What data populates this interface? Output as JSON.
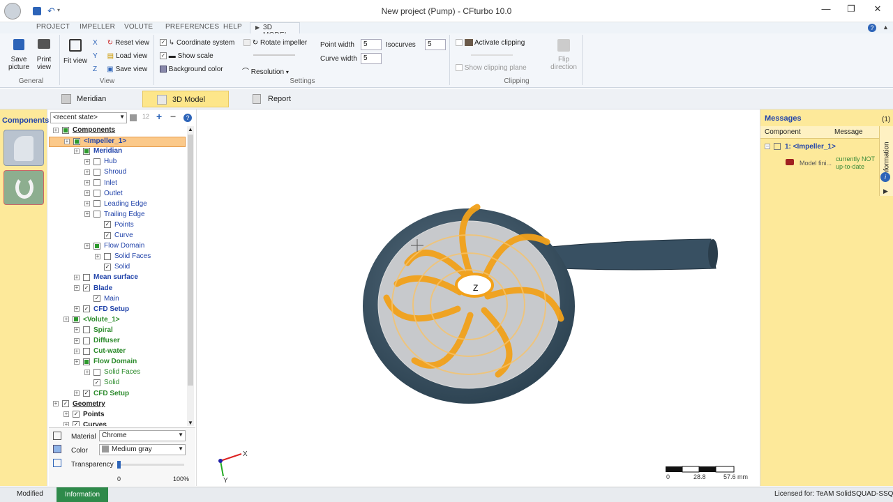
{
  "window": {
    "title": "New project (Pump) - CFturbo 10.0"
  },
  "ribbon_tabs": [
    "PROJECT",
    "IMPELLER",
    "VOLUTE",
    "PREFERENCES",
    "HELP",
    "3D MODEL"
  ],
  "general": {
    "save_picture": "Save picture",
    "print_view": "Print view",
    "label": "General"
  },
  "view": {
    "fit_view": "Fit view",
    "reset_view": "Reset view",
    "load_view": "Load view",
    "save_view": "Save view",
    "label": "View"
  },
  "settings": {
    "coordinate_system": "Coordinate system",
    "show_scale": "Show scale",
    "background_color": "Background color",
    "rotate_impeller": "Rotate impeller",
    "resolution": "Resolution",
    "point_width_label": "Point width",
    "point_width": "5",
    "curve_width_label": "Curve width",
    "curve_width": "5",
    "isocurves_label": "Isocurves",
    "isocurves": "5",
    "label": "Settings"
  },
  "clipping": {
    "activate": "Activate clipping",
    "show_plane": "Show clipping plane",
    "flip": "Flip direction",
    "label": "Clipping"
  },
  "view_tabs": {
    "meridian": "Meridian",
    "model3d": "3D Model",
    "report": "Report"
  },
  "left_bar": {
    "title": "Components"
  },
  "tree": {
    "state_select": "<recent state>",
    "items": [
      {
        "label": "Components",
        "style": "bold-ul",
        "level": 0,
        "check": "f"
      },
      {
        "label": "<Impeller_1>",
        "style": "sel",
        "level": 1,
        "check": "f"
      },
      {
        "label": "Meridian",
        "style": "bold-blue",
        "level": 2,
        "check": "f"
      },
      {
        "label": "Hub",
        "style": "blue",
        "level": 3,
        "check": ""
      },
      {
        "label": "Shroud",
        "style": "blue",
        "level": 3,
        "check": ""
      },
      {
        "label": "Inlet",
        "style": "blue",
        "level": 3,
        "check": ""
      },
      {
        "label": "Outlet",
        "style": "blue",
        "level": 3,
        "check": ""
      },
      {
        "label": "Leading Edge",
        "style": "blue",
        "level": 3,
        "check": ""
      },
      {
        "label": "Trailing Edge",
        "style": "blue",
        "level": 3,
        "check": ""
      },
      {
        "label": "Points",
        "style": "blue",
        "level": 4,
        "check": "c"
      },
      {
        "label": "Curve",
        "style": "blue",
        "level": 4,
        "check": "c"
      },
      {
        "label": "Flow Domain",
        "style": "blue",
        "level": 3,
        "check": "f"
      },
      {
        "label": "Solid Faces",
        "style": "blue",
        "level": 4,
        "check": ""
      },
      {
        "label": "Solid",
        "style": "blue",
        "level": 4,
        "check": "c"
      },
      {
        "label": "Mean surface",
        "style": "bold-blue",
        "level": 2,
        "check": ""
      },
      {
        "label": "Blade",
        "style": "bold-blue",
        "level": 2,
        "check": "c"
      },
      {
        "label": "Main",
        "style": "blue",
        "level": 3,
        "check": "c"
      },
      {
        "label": "CFD Setup",
        "style": "bold-blue",
        "level": 2,
        "check": "c"
      },
      {
        "label": "<Volute_1>",
        "style": "bold-green",
        "level": 1,
        "check": "f"
      },
      {
        "label": "Spiral",
        "style": "bold-green",
        "level": 2,
        "check": ""
      },
      {
        "label": "Diffuser",
        "style": "bold-green",
        "level": 2,
        "check": ""
      },
      {
        "label": "Cut-water",
        "style": "bold-green",
        "level": 2,
        "check": ""
      },
      {
        "label": "Flow Domain",
        "style": "bold-green",
        "level": 2,
        "check": "f"
      },
      {
        "label": "Solid Faces",
        "style": "green",
        "level": 3,
        "check": ""
      },
      {
        "label": "Solid",
        "style": "green",
        "level": 3,
        "check": "c"
      },
      {
        "label": "CFD Setup",
        "style": "bold-green",
        "level": 2,
        "check": "c"
      },
      {
        "label": "Geometry",
        "style": "bold-ul",
        "level": 0,
        "check": "c"
      },
      {
        "label": "Points",
        "style": "bold",
        "level": 1,
        "check": "c"
      },
      {
        "label": "Curves",
        "style": "bold",
        "level": 1,
        "check": "c"
      }
    ]
  },
  "props": {
    "material_label": "Material",
    "material": "Chrome",
    "color_label": "Color",
    "color": "Medium gray",
    "transparency_label": "Transparency",
    "t_min": "0",
    "t_max": "100%",
    "transparency": 0
  },
  "scale": {
    "t0": "0",
    "t1": "28.8",
    "t2": "57.6 mm"
  },
  "axes": {
    "x": "X",
    "y": "Y",
    "z": "Z"
  },
  "messages": {
    "title": "Messages",
    "count": "(1)",
    "col_component": "Component",
    "col_message": "Message",
    "item": "1: <Impeller_1>",
    "model": "Model fini...",
    "status": "currently NOT up-to-date",
    "side_tab": "Information"
  },
  "status": {
    "modified": "Modified",
    "information": "Information",
    "licensed": "Licensed for: TeAM SolidSQUAD-SSQ"
  }
}
